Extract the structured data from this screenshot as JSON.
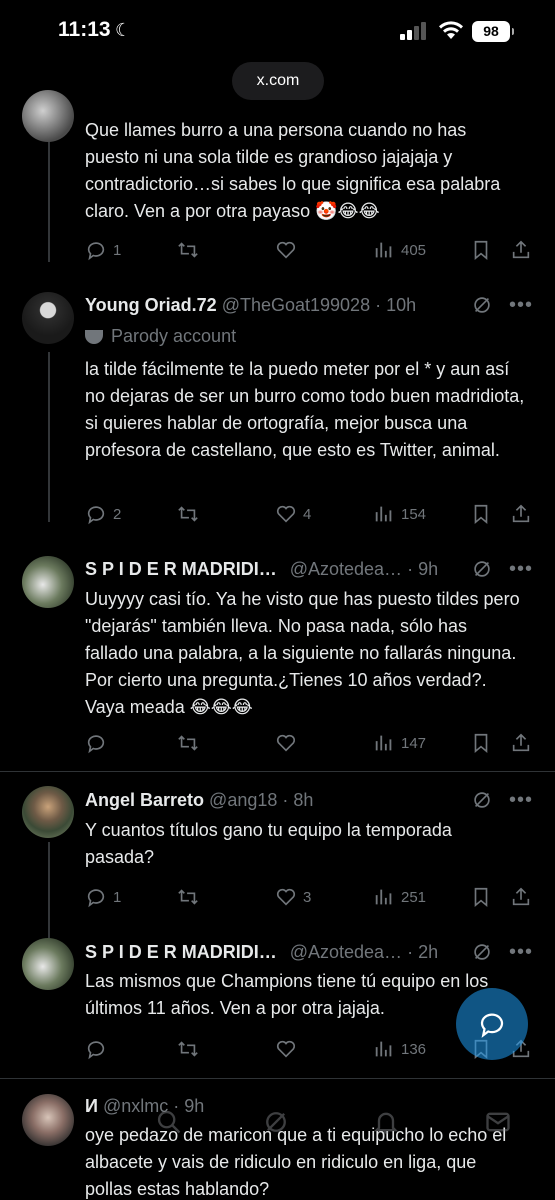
{
  "status_bar": {
    "time": "11:13",
    "battery": "98"
  },
  "browser": {
    "url": "x.com"
  },
  "tweets": [
    {
      "text": "Que llames burro a una persona cuando no has puesto ni una sola tilde es grandioso jajajaja y contradictorio…si sabes lo que significa esa palabra claro. Ven a por otra payaso 🤡😂😂",
      "replies": "1",
      "retweets": "",
      "likes": "",
      "views": "405"
    },
    {
      "name": "Young Oriad.72",
      "handle": "@TheGoat199028",
      "time": "· 10h",
      "badge": "Parody account",
      "text": "la tilde fácilmente te la puedo meter por el * y aun así no dejaras de ser un burro como todo buen madridiota, si quieres hablar de ortografía, mejor busca una profesora de castellano, que esto es Twitter, animal.",
      "replies": "2",
      "retweets": "",
      "likes": "4",
      "views": "154"
    },
    {
      "name": "S P I D E R MADRIDI…",
      "handle": "@Azotedea…",
      "time": "· 9h",
      "text": "Uuyyyy casi tío. Ya he visto que has puesto tildes pero \"dejarás\" también lleva. No pasa nada, sólo has fallado una palabra, a la siguiente no fallarás ninguna. Por cierto una pregunta.¿Tienes 10 años verdad?. Vaya meada 😂😂😂",
      "replies": "",
      "retweets": "",
      "likes": "",
      "views": "147"
    },
    {
      "name": "Angel Barreto",
      "handle": "@ang18",
      "time": "· 8h",
      "text": "Y cuantos títulos gano tu equipo la temporada pasada?",
      "replies": "1",
      "retweets": "",
      "likes": "3",
      "views": "251"
    },
    {
      "name": "S P I D E R MADRIDI…",
      "handle": "@Azotedea…",
      "time": "· 2h",
      "text": "Las mismos que Champions tiene tú equipo en los últimos 11 años. Ven a por otra jajaja.",
      "replies": "",
      "retweets": "",
      "likes": "",
      "views": "136"
    },
    {
      "name": "И",
      "handle": "@nxlmc",
      "time": "· 9h",
      "text": "oye pedazo de maricon que a ti equipucho lo echo el albacete y vais de ridiculo en ridiculo en liga, que pollas estas hablando?"
    }
  ],
  "colors": {
    "accent": "#1d9bf0",
    "text": "#e7e9ea",
    "muted": "#71767b",
    "background": "#000000"
  }
}
